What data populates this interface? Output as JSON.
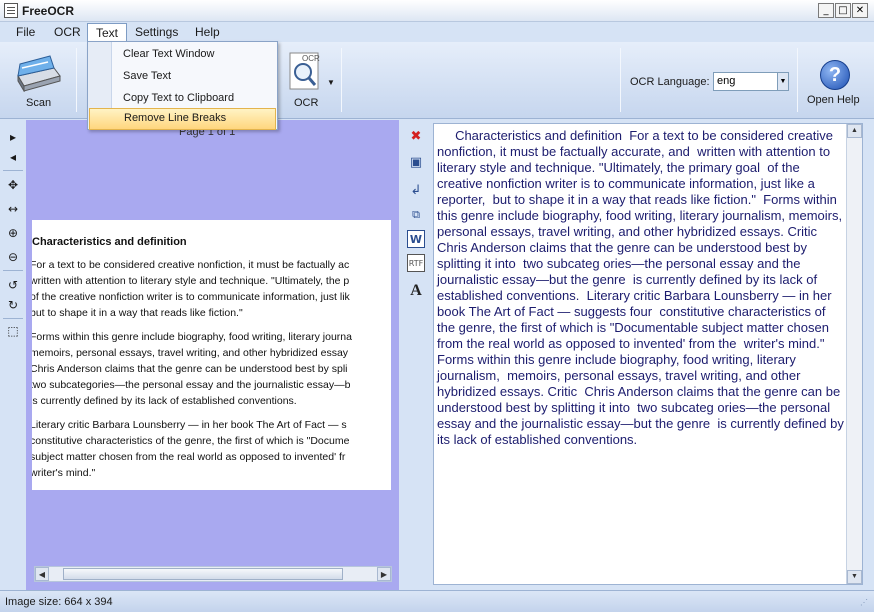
{
  "window": {
    "title": "FreeOCR",
    "minimize": "_",
    "maximize": "□",
    "close": "✕"
  },
  "menu": {
    "items": [
      "File",
      "OCR",
      "Text",
      "Settings",
      "Help"
    ],
    "text_dropdown": [
      "Clear Text Window",
      "Save Text",
      "Copy Text to Clipboard",
      "Remove Line Breaks"
    ],
    "highlighted": "Remove Line Breaks"
  },
  "toolbar": {
    "scan_label": "Scan",
    "ocr_label": "OCR",
    "ocr_badge": "OCR",
    "language_label": "OCR Language:",
    "language_value": "eng",
    "help_label": "Open Help",
    "help_glyph": "?"
  },
  "image_panel": {
    "page_label": "Page 1 of 1",
    "heading": "Characteristics and definition",
    "lines": [
      "For a text to be considered creative nonfiction, it must be factually ac",
      "written with attention to literary style and technique. \"Ultimately, the p",
      "of the creative nonfiction writer is to communicate information, just lik",
      "but to shape it in a way that reads like fiction.\"",
      "Forms within this genre include biography, food writing, literary journa",
      "memoirs, personal essays, travel writing, and other hybridized essay",
      "Chris Anderson claims that the genre can be understood best by spli",
      "two subcategories—the personal essay and the journalistic essay—b",
      "is currently defined by its lack of established conventions.",
      "Literary critic Barbara Lounsberry — in her book The Art of Fact — s",
      "constitutive characteristics of the genre, the first of which is \"Docume",
      "subject matter chosen from the real world as opposed to invented' fr",
      "writer's mind.\""
    ]
  },
  "ocr_text": "     Characteristics and definition  For a text to be considered creative nonfiction, it must be factually accurate, and  written with attention to literary style and technique. \"Ultimately, the primary goal  of the creative nonfiction writer is to communicate information, just like a reporter,  but to shape it in a way that reads like fiction.\"  Forms within this genre include biography, food writing, literary journalism, memoirs, personal essays, travel writing, and other hybridized essays. Critic  Chris Anderson claims that the genre can be understood best by splitting it into  two subcateg ories—the personal essay and the journalistic essay—but the genre  is currently defined by its lack of established conventions.  Literary critic Barbara Lounsberry — in her book The Art of Fact — suggests four  constitutive characteristics of the genre, the first of which is \"Documentable subject matter chosen from the real world as opposed to invented' from the  writer's mind.\"       Forms within this genre include biography, food writing, literary journalism,  memoirs, personal essays, travel writing, and other hybridized essays. Critic  Chris Anderson claims that the genre can be understood best by splitting it into  two subcateg ories—the personal essay and the journalistic essay—but the genre  is currently defined by its lack of established conventions.",
  "status": {
    "text": "Image size:  664 x 394"
  },
  "colors": {
    "image_bg": "#a9a9f0",
    "ocr_text": "#1c1c6e",
    "highlight": "#ffd67e"
  }
}
